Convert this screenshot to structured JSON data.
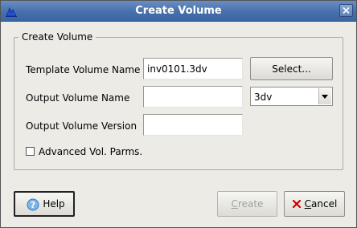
{
  "window": {
    "title": "Create Volume"
  },
  "group": {
    "title": "Create Volume"
  },
  "fields": {
    "template_label": "Template Volume Name",
    "template_value": "inv0101.3dv",
    "output_label": "Output Volume Name",
    "output_value": "",
    "version_label": "Output Volume Version",
    "version_value": ""
  },
  "select_button": {
    "label": "Select..."
  },
  "extension_select": {
    "selected": "3dv"
  },
  "advanced": {
    "label": "Advanced Vol. Parms.",
    "checked": false
  },
  "buttons": {
    "help": {
      "label": "Help",
      "icon": "help-icon"
    },
    "create": {
      "first": "C",
      "rest": "reate",
      "enabled": false
    },
    "cancel": {
      "first": "C",
      "rest": "ancel",
      "icon": "cancel-x-icon"
    }
  },
  "colors": {
    "titlebar": "#4670ad",
    "background": "#ecebe6",
    "cancel_icon": "#d00000",
    "help_icon": "#5aa0d8"
  }
}
